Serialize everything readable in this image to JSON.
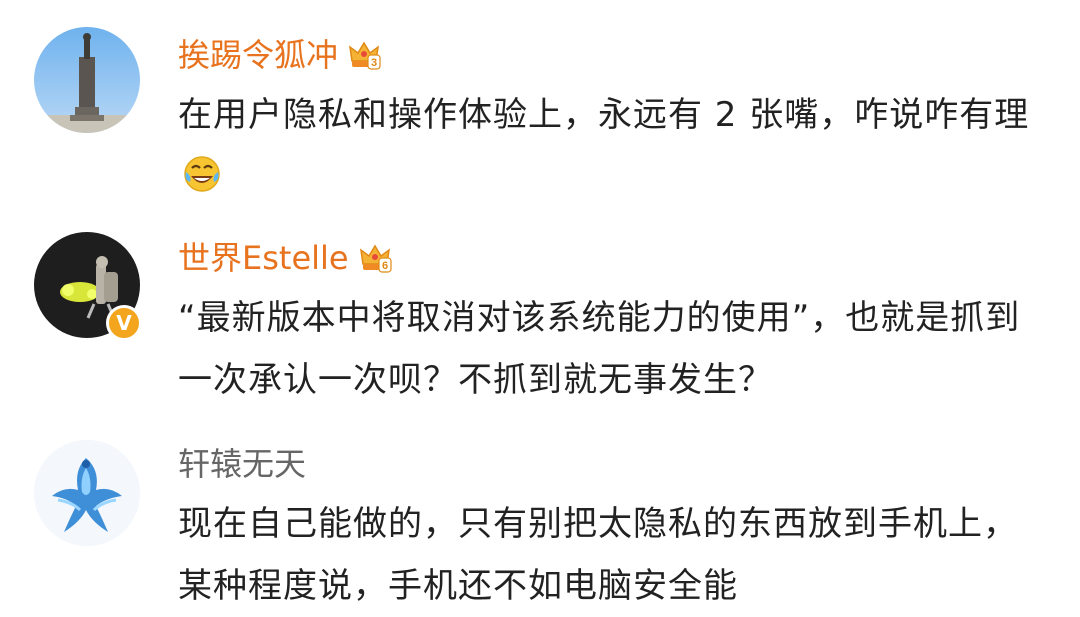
{
  "comments": [
    {
      "username": "挨踢令狐冲",
      "username_color": "#e8731f",
      "vip_level": "3",
      "text": "在用户隐私和操作体验上，永远有 2 张嘴，咋说咋有理",
      "emoji": "laugh-cry-emoji"
    },
    {
      "username": "世界Estelle",
      "username_color": "#e8731f",
      "vip_level": "6",
      "verified": "V",
      "text": "“最新版本中将取消对该系统能力的使用”，也就是抓到一次承认一次呗？不抓到就无事发生？"
    },
    {
      "username": "轩辕无天",
      "username_color": "#666666",
      "text": "现在自己能做的，只有别把太隐私的东西放到手机上，某种程度说，手机还不如电脑安全能"
    }
  ]
}
